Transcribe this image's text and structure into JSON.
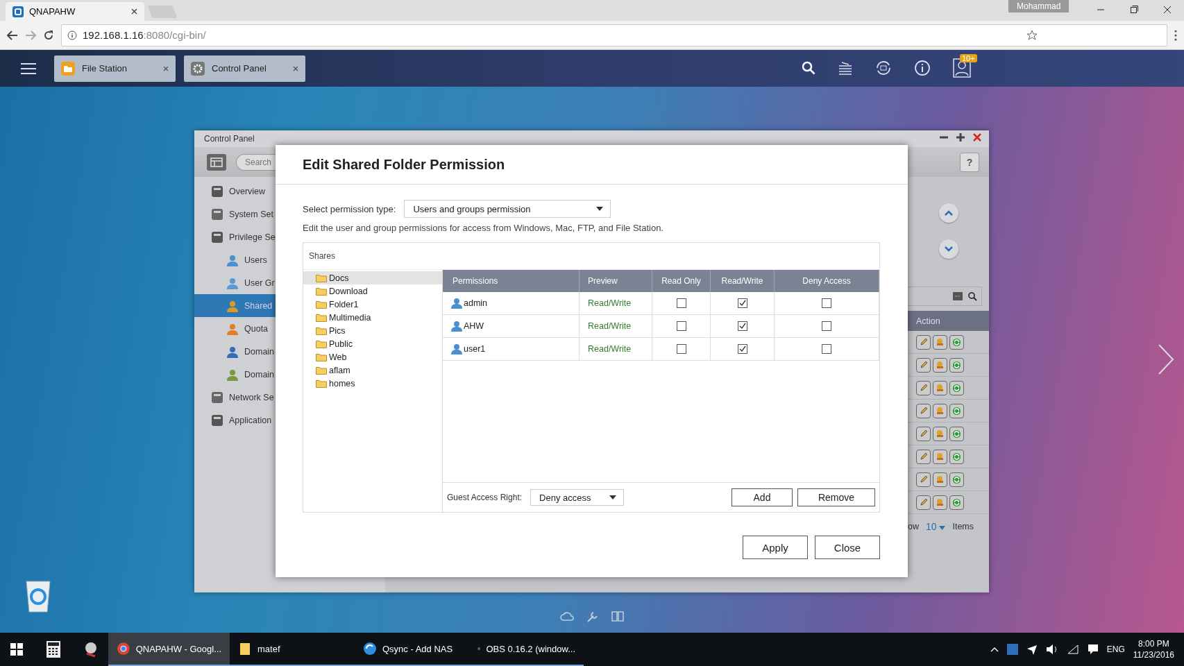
{
  "browser": {
    "tab_title": "QNAPAHW",
    "profile": "Mohammad",
    "address": {
      "host": "192.168.1.16",
      "path": ":8080/cgi-bin/"
    }
  },
  "qnap_bar": {
    "tabs": [
      {
        "label": "File Station"
      },
      {
        "label": "Control Panel"
      }
    ],
    "notification_badge": "10+"
  },
  "control_panel": {
    "title": "Control Panel",
    "search_placeholder": "Search",
    "help_label": "?",
    "sidebar": [
      {
        "label": "Overview",
        "selected": false
      },
      {
        "label": "System Set",
        "selected": false
      },
      {
        "label": "Privilege Se",
        "selected": false,
        "children": [
          {
            "label": "Users",
            "selected": false
          },
          {
            "label": "User Gr",
            "selected": false
          },
          {
            "label": "Shared",
            "selected": true
          },
          {
            "label": "Quota",
            "selected": false
          },
          {
            "label": "Domain",
            "selected": false
          },
          {
            "label": "Domain",
            "selected": false
          }
        ]
      },
      {
        "label": "Network Se",
        "selected": false
      },
      {
        "label": "Application",
        "selected": false
      }
    ],
    "action_header": "Action",
    "footer": {
      "show_prefix": "ow",
      "page_size": "10",
      "items_label": "Items"
    }
  },
  "dialog": {
    "title": "Edit Shared Folder Permission",
    "permission_type_label": "Select permission type:",
    "permission_type": "Users and groups permission",
    "description": "Edit the user and group permissions for access from Windows, Mac, FTP, and File Station.",
    "shares_label": "Shares",
    "folders": [
      {
        "name": "Docs",
        "selected": true
      },
      {
        "name": "Download",
        "selected": false
      },
      {
        "name": "Folder1",
        "selected": false
      },
      {
        "name": "Multimedia",
        "selected": false
      },
      {
        "name": "Pics",
        "selected": false
      },
      {
        "name": "Public",
        "selected": false
      },
      {
        "name": "Web",
        "selected": false
      },
      {
        "name": "aflam",
        "selected": false
      },
      {
        "name": "homes",
        "selected": false
      }
    ],
    "columns": [
      "Permissions",
      "Preview",
      "Read Only",
      "Read/Write",
      "Deny Access"
    ],
    "rows": [
      {
        "name": "admin",
        "preview": "Read/Write",
        "read_only": false,
        "read_write": true,
        "deny_access": false
      },
      {
        "name": "AHW",
        "preview": "Read/Write",
        "read_only": false,
        "read_write": true,
        "deny_access": false
      },
      {
        "name": "user1",
        "preview": "Read/Write",
        "read_only": false,
        "read_write": true,
        "deny_access": false
      }
    ],
    "guest_label": "Guest Access Right:",
    "guest_value": "Deny access",
    "add_button": "Add",
    "remove_button": "Remove",
    "apply_button": "Apply",
    "close_button": "Close"
  },
  "taskbar": {
    "apps": [
      {
        "label": "QNAPAHW - Googl...",
        "selected": true
      },
      {
        "label": "matef",
        "selected": false
      },
      {
        "label": "Qsync - Add NAS",
        "selected": false
      },
      {
        "label": "OBS 0.16.2 (window...",
        "selected": false
      }
    ],
    "language": "ENG",
    "time": "8:00 PM",
    "date": "11/23/2016"
  }
}
